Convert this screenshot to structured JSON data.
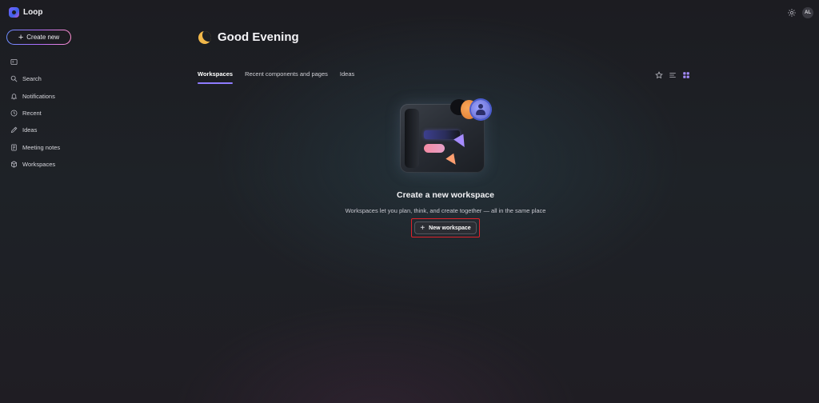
{
  "app": {
    "name": "Loop"
  },
  "topbar": {
    "settings_icon": "gear-icon",
    "avatar_initials": "AL"
  },
  "sidebar": {
    "create_label": "Create new",
    "items": [
      {
        "label": "",
        "icon": "panel-icon"
      },
      {
        "label": "Search",
        "icon": "search-icon"
      },
      {
        "label": "Notifications",
        "icon": "bell-icon"
      },
      {
        "label": "Recent",
        "icon": "clock-icon"
      },
      {
        "label": "Ideas",
        "icon": "pen-icon"
      },
      {
        "label": "Meeting notes",
        "icon": "notes-icon"
      },
      {
        "label": "Workspaces",
        "icon": "cube-icon"
      }
    ]
  },
  "main": {
    "greeting": "Good Evening",
    "tabs": [
      {
        "label": "Workspaces",
        "active": true
      },
      {
        "label": "Recent components and pages",
        "active": false
      },
      {
        "label": "Ideas",
        "active": false
      }
    ],
    "view_tools": [
      "star-icon",
      "list-view-icon",
      "grid-view-icon"
    ],
    "empty_state": {
      "title": "Create a new workspace",
      "description": "Workspaces let you plan, think, and create together — all in the same place",
      "button_label": "New workspace"
    }
  },
  "colors": {
    "accent": "#8f7cff",
    "highlight_outline": "#e0222a",
    "moon": "#f1b84a"
  }
}
